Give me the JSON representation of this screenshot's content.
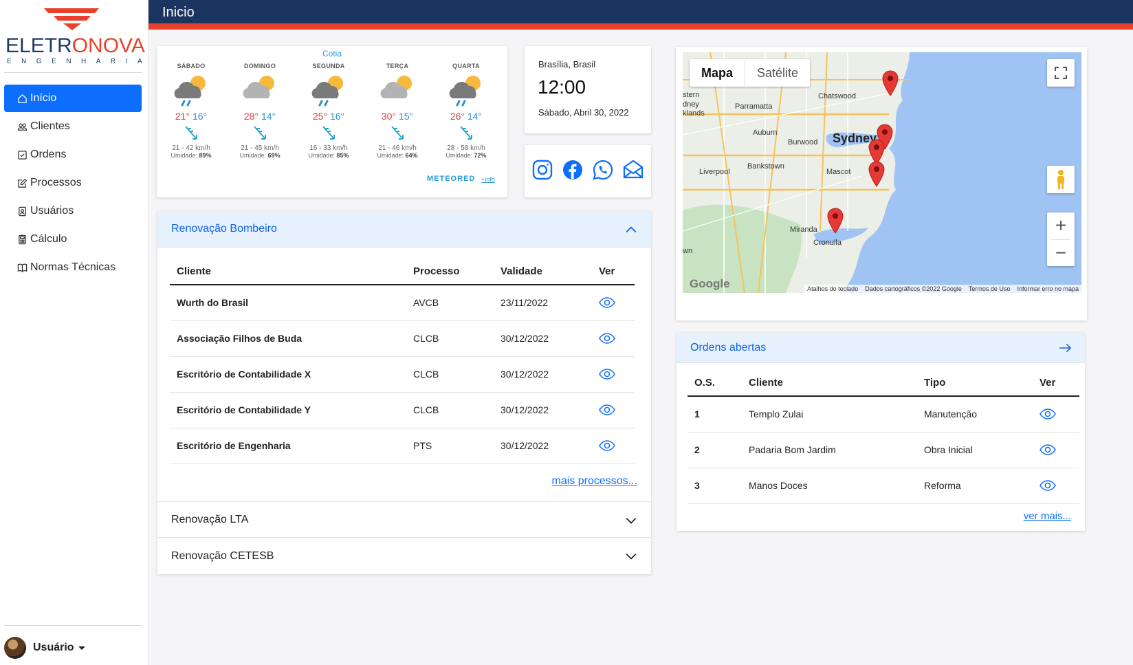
{
  "brand": {
    "word_a": "ELETR",
    "word_b": "ONOVA",
    "subtitle": "ENGENHARIA"
  },
  "page_title": "Inicio",
  "sidebar": {
    "items": [
      {
        "label": "Início",
        "icon": "house-icon",
        "active": true
      },
      {
        "label": "Clientes",
        "icon": "people-icon"
      },
      {
        "label": "Ordens",
        "icon": "checklist-icon"
      },
      {
        "label": "Processos",
        "icon": "edit-icon"
      },
      {
        "label": "Usuários",
        "icon": "person-badge-icon"
      },
      {
        "label": "Cálculo",
        "icon": "calculator-icon"
      },
      {
        "label": "Normas Técnicas",
        "icon": "book-icon"
      }
    ],
    "user": "Usuário"
  },
  "weather": {
    "city": "Cotia",
    "days": [
      {
        "name": "SÁBADO",
        "max": "21°",
        "min": "16°",
        "wind": "21 - 42 km/h",
        "hum_label": "Umidade:",
        "hum": "89%",
        "rain": true
      },
      {
        "name": "DOMINGO",
        "max": "28°",
        "min": "14°",
        "wind": "21 - 45 km/h",
        "hum_label": "Umidade:",
        "hum": "69%",
        "rain": false
      },
      {
        "name": "SEGUNDA",
        "max": "25°",
        "min": "16°",
        "wind": "16 - 33 km/h",
        "hum_label": "Umidade:",
        "hum": "85%",
        "rain": true
      },
      {
        "name": "TERÇA",
        "max": "30°",
        "min": "15°",
        "wind": "21 - 46 km/h",
        "hum_label": "Umidade:",
        "hum": "64%",
        "rain": false
      },
      {
        "name": "QUARTA",
        "max": "26°",
        "min": "14°",
        "wind": "28 - 58 km/h",
        "hum_label": "Umidade:",
        "hum": "72%",
        "rain": true
      }
    ],
    "provider": "METEORED",
    "info": "+info"
  },
  "clock": {
    "location": "Brasília, Brasil",
    "time": "12:00",
    "date": "Sábado, Abril 30, 2022"
  },
  "social": [
    "instagram-icon",
    "facebook-icon",
    "whatsapp-icon",
    "mail-icon"
  ],
  "accordion": {
    "bombeiro": {
      "title": "Renovação Bombeiro",
      "headers": [
        "Cliente",
        "Processo",
        "Validade",
        "Ver"
      ],
      "rows": [
        {
          "cliente": "Wurth do Brasil",
          "processo": "AVCB",
          "validade": "23/11/2022"
        },
        {
          "cliente": "Associação Filhos de Buda",
          "processo": "CLCB",
          "validade": "30/12/2022"
        },
        {
          "cliente": "Escritório de Contabilidade X",
          "processo": "CLCB",
          "validade": "30/12/2022"
        },
        {
          "cliente": "Escritório de Contabilidade Y",
          "processo": "CLCB",
          "validade": "30/12/2022"
        },
        {
          "cliente": "Escritório de Engenharia",
          "processo": "PTS",
          "validade": "30/12/2022"
        }
      ],
      "more": "mais processos..."
    },
    "lta": {
      "title": "Renovação LTA"
    },
    "cetesb": {
      "title": "Renovação CETESB"
    }
  },
  "map": {
    "tabs": [
      "Mapa",
      "Satélite"
    ],
    "labels": [
      "Sydney",
      "Chatswood",
      "Parramatta",
      "Auburn",
      "Burwood",
      "Bankstown",
      "Liverpool",
      "Mascot",
      "Miranda",
      "Cronulla",
      "stern",
      "dney",
      "klands",
      "wn"
    ],
    "credits": [
      "Atalhos do teclado",
      "Dados cartográficos ©2022 Google",
      "Termos de Uso",
      "Informar erro no mapa"
    ],
    "google": "Google"
  },
  "orders": {
    "title": "Ordens abertas",
    "headers": [
      "O.S.",
      "Cliente",
      "Tipo",
      "Ver"
    ],
    "rows": [
      {
        "os": "1",
        "cliente": "Templo Zulai",
        "tipo": "Manutenção"
      },
      {
        "os": "2",
        "cliente": "Padaria Bom Jardim",
        "tipo": "Obra Inicial"
      },
      {
        "os": "3",
        "cliente": "Manos Doces",
        "tipo": "Reforma"
      }
    ],
    "more": "ver mais..."
  },
  "colors": {
    "brand_blue": "#1b3460",
    "brand_red": "#e8412b",
    "primary": "#0d6efd"
  }
}
